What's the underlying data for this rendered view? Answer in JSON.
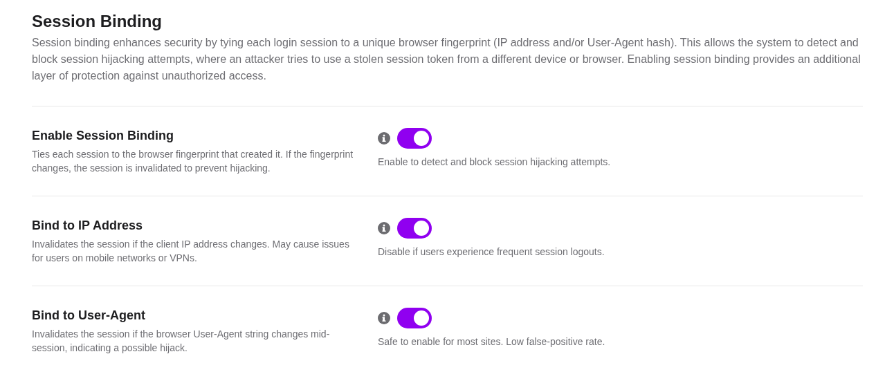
{
  "section": {
    "title": "Session Binding",
    "description": "Session binding enhances security by tying each login session to a unique browser fingerprint (IP address and/or User-Agent hash). This allows the system to detect and block session hijacking attempts, where an attacker tries to use a stolen session token from a different device or browser. Enabling session binding provides an additional layer of protection against unauthorized access."
  },
  "settings": [
    {
      "label": "Enable Session Binding",
      "description": "Ties each session to the browser fingerprint that created it. If the fingerprint changes, the session is invalidated to prevent hijacking.",
      "on": true,
      "help": "Enable to detect and block session hijacking attempts."
    },
    {
      "label": "Bind to IP Address",
      "description": "Invalidates the session if the client IP address changes. May cause issues for users on mobile networks or VPNs.",
      "on": true,
      "help": "Disable if users experience frequent session logouts."
    },
    {
      "label": "Bind to User-Agent",
      "description": "Invalidates the session if the browser User-Agent string changes mid-session, indicating a possible hijack.",
      "on": true,
      "help": "Safe to enable for most sites. Low false-positive rate."
    }
  ]
}
